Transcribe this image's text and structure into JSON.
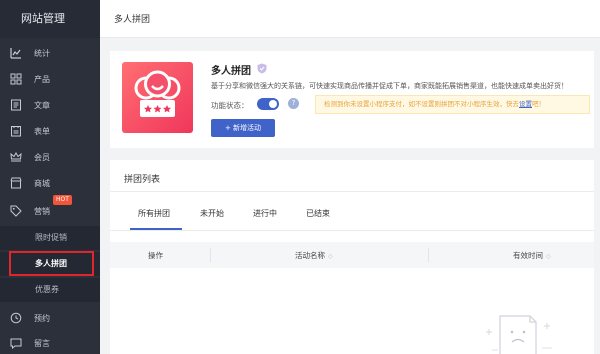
{
  "sidebar": {
    "title": "网站管理",
    "hot_badge": "HOT",
    "items": [
      {
        "label": "统计",
        "icon": "chart-icon"
      },
      {
        "label": "产品",
        "icon": "grid-icon"
      },
      {
        "label": "文章",
        "icon": "article-icon"
      },
      {
        "label": "表单",
        "icon": "form-icon"
      },
      {
        "label": "会员",
        "icon": "crown-icon"
      },
      {
        "label": "商城",
        "icon": "store-icon"
      },
      {
        "label": "营销",
        "icon": "tag-icon"
      },
      {
        "label": "预约",
        "icon": "clock-icon"
      },
      {
        "label": "留言",
        "icon": "message-icon"
      }
    ],
    "subitems": [
      {
        "label": "限时促销"
      },
      {
        "label": "多人拼团"
      },
      {
        "label": "优惠券"
      }
    ]
  },
  "header": {
    "title": "多人拼团"
  },
  "feature": {
    "title": "多人拼团",
    "description": "基于分享和微信强大的关系链，可快速实现商品传播并促成下单，商家既能拓展销售渠道，也能快速成单卖出好货！",
    "status_label": "功能状态：",
    "status_on": true,
    "help": "?",
    "notice_text": "检测到你未设置小程序支付，如不设置则拼团不对小程序生效，快去",
    "notice_link": "设置",
    "notice_end": "吧！",
    "new_button": "+ 新增活动"
  },
  "list": {
    "title": "拼团列表",
    "tabs": [
      "所有拼团",
      "未开始",
      "进行中",
      "已结束"
    ],
    "active_tab": "所有拼团",
    "columns": [
      "操作",
      "活动名称",
      "有效时间"
    ]
  },
  "colors": {
    "sidebar_bg": "#2b303b",
    "accent": "#3f63c8",
    "hot": "#f2553a",
    "highlight": "#e0262b"
  }
}
